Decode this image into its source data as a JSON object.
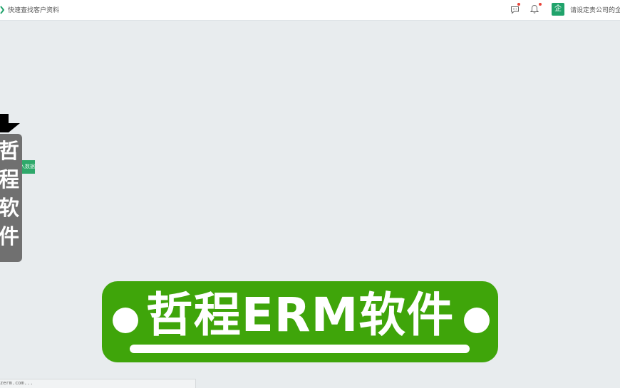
{
  "topbar": {
    "search_text": "快速查找客户资料",
    "company_text": "请设定贵公司的全",
    "company_icon_char": "企",
    "icons": [
      "search-icon",
      "chat-icon",
      "bell-icon",
      "company-icon"
    ]
  },
  "overlay": {
    "vertical_chars": [
      "哲",
      "程",
      "软",
      "件"
    ],
    "green_tag_text": "入数据"
  },
  "caption": {
    "text": "哲程ERM软件"
  },
  "status": {
    "text": "zerm.com..."
  },
  "colors": {
    "accent": "#20a36b",
    "caption_green": "#3fa50a",
    "banner_gray": "#707070",
    "background": "#e8ecee"
  }
}
